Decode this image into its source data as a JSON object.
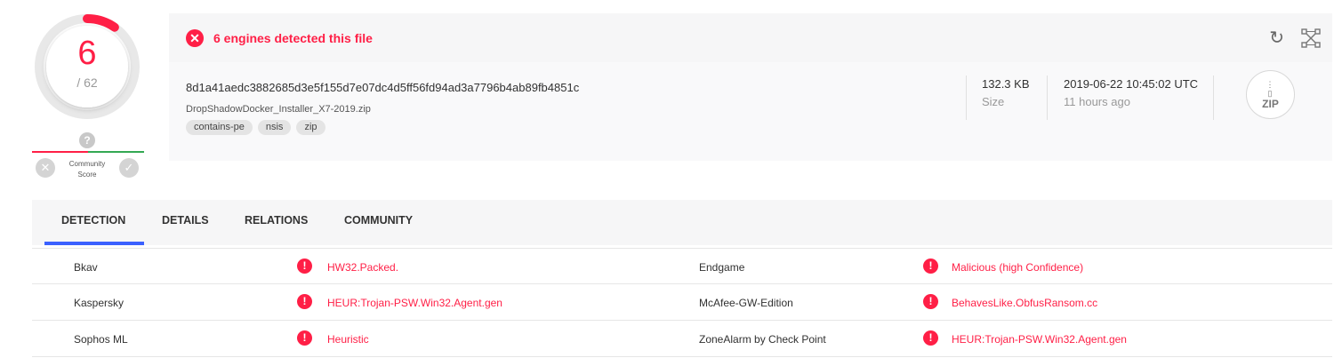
{
  "score": {
    "detected": "6",
    "total": "/ 62",
    "ratio": 0.0968,
    "community_label_1": "Community",
    "community_label_2": "Score",
    "question_glyph": "?"
  },
  "header": {
    "detection_message": "6 engines detected this file",
    "reload_icon": "reload-icon",
    "graph_icon": "graph-icon"
  },
  "file": {
    "hash": "8d1a41aedc3882685d3e5f155d7e07dc4d5ff56fd94ad3a7796b4ab89fb4851c",
    "name": "DropShadowDocker_Installer_X7-2019.zip",
    "tags": [
      "contains-pe",
      "nsis",
      "zip"
    ],
    "size_value": "132.3 KB",
    "size_label": "Size",
    "date_value": "2019-06-22 10:45:02 UTC",
    "date_relative": "11 hours ago",
    "type_icon_label": "ZIP"
  },
  "tabs": [
    {
      "label": "DETECTION",
      "active": true
    },
    {
      "label": "DETAILS",
      "active": false
    },
    {
      "label": "RELATIONS",
      "active": false
    },
    {
      "label": "COMMUNITY",
      "active": false
    }
  ],
  "detections": [
    {
      "left_engine": "Bkav",
      "left_result": "HW32.Packed.",
      "right_engine": "Endgame",
      "right_result": "Malicious (high Confidence)"
    },
    {
      "left_engine": "Kaspersky",
      "left_result": "HEUR:Trojan-PSW.Win32.Agent.gen",
      "right_engine": "McAfee-GW-Edition",
      "right_result": "BehavesLike.ObfusRansom.cc"
    },
    {
      "left_engine": "Sophos ML",
      "left_result": "Heuristic",
      "right_engine": "ZoneAlarm by Check Point",
      "right_result": "HEUR:Trojan-PSW.Win32.Agent.gen"
    }
  ],
  "colors": {
    "alert_red": "#ff1f46",
    "accent_blue": "#3b61ff",
    "community_positive": "#34a853"
  }
}
